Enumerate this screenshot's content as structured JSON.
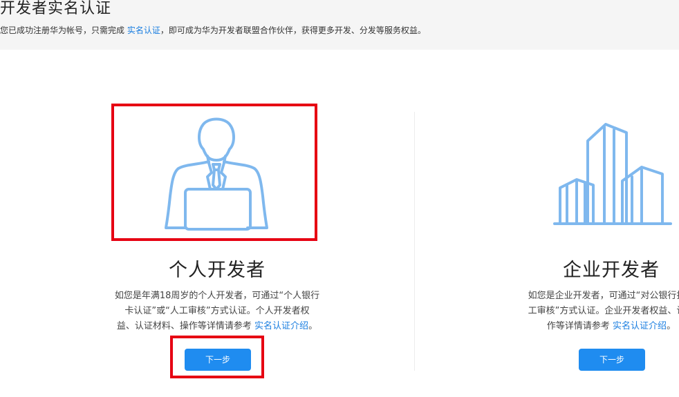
{
  "header": {
    "title": "开发者实名认证",
    "subtitle_before": "您已成功注册华为帐号，只需完成 ",
    "subtitle_link": "实名认证",
    "subtitle_after": "，即可成为华为开发者联盟合作伙伴，获得更多开发、分发等服务权益。"
  },
  "personal": {
    "icon": "businessman-laptop-icon",
    "title": "个人开发者",
    "desc_line1": "如您是年满18周岁的个人开发者，可通过“个人银行",
    "desc_line2": "卡认证”或“人工审核”方式认证。个人开发者权",
    "desc_line3_before": "益、认证材料、操作等详情请参考 ",
    "desc_link": "实名认证介绍",
    "desc_line3_after": "。",
    "button": "下一步"
  },
  "enterprise": {
    "icon": "buildings-icon",
    "title": "企业开发者",
    "desc_line1": "如您是企业开发者，可通过“对公银行打款",
    "desc_line2": "工审核”方式认证。企业开发者权益、认证",
    "desc_line3_before": "作等详情请参考 ",
    "desc_link": "实名认证介绍",
    "desc_line3_after": "。",
    "button": "下一步"
  },
  "colors": {
    "accent": "#1f8cf0",
    "link": "#1a7ee0",
    "icon": "#7fb8ee",
    "highlight": "#e60012"
  }
}
